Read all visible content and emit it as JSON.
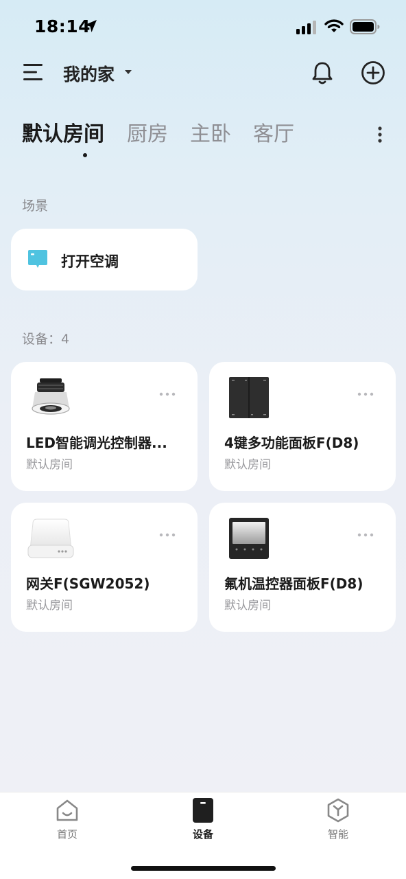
{
  "status_bar": {
    "time": "18:14",
    "icons": [
      "location-arrow-icon",
      "cellular-signal-icon",
      "wifi-icon",
      "battery-icon"
    ]
  },
  "header": {
    "home_name": "我的家",
    "icons": [
      "menu-icon",
      "caret-down-icon",
      "bell-icon",
      "add-circle-icon"
    ]
  },
  "rooms": {
    "tabs": [
      "默认房间",
      "厨房",
      "主卧",
      "客厅"
    ],
    "active_index": 0
  },
  "scenes": {
    "section_label": "场景",
    "items": [
      {
        "name": "打开空调",
        "icon": "scene-flag-icon",
        "icon_color": "#4fc3e0"
      }
    ]
  },
  "devices": {
    "section_label": "设备：4",
    "items": [
      {
        "name": "LED智能调光控制器...",
        "room": "默认房间",
        "image": "downlight-image"
      },
      {
        "name": "4键多功能面板F(D8)",
        "room": "默认房间",
        "image": "switch-panel-image"
      },
      {
        "name": "网关F(SGW2052)",
        "room": "默认房间",
        "image": "gateway-image"
      },
      {
        "name": "氟机温控器面板F(D8)",
        "room": "默认房间",
        "image": "thermostat-panel-image"
      }
    ]
  },
  "tab_bar": {
    "items": [
      {
        "label": "首页",
        "icon": "home-icon"
      },
      {
        "label": "设备",
        "icon": "device-icon"
      },
      {
        "label": "智能",
        "icon": "smart-cube-icon"
      }
    ],
    "active_index": 1
  }
}
